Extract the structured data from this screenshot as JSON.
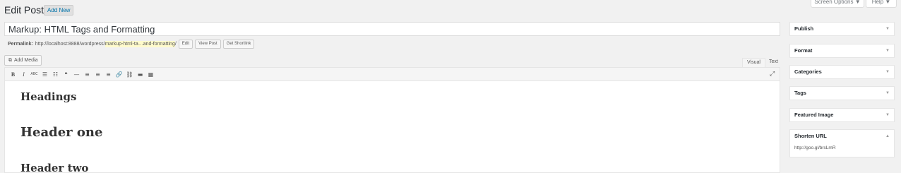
{
  "header": {
    "title": "Edit Post",
    "add_new": "Add New",
    "screen_options": "Screen Options ▼",
    "help": "Help ▼"
  },
  "post": {
    "title": "Markup: HTML Tags and Formatting",
    "permalink_label": "Permalink:",
    "permalink_base": "http://localhost:8888/wordpress/",
    "permalink_slug": "markup-html-ta…and-formatting",
    "permalink_end": "/",
    "edit_btn": "Edit",
    "view_post_btn": "View Post",
    "shortlink_btn": "Get Shortlink"
  },
  "editor": {
    "add_media": "Add Media",
    "tab_visual": "Visual",
    "tab_text": "Text",
    "toolbar": [
      "B",
      "I",
      "ABC",
      "☰",
      "☷",
      "❝",
      "—",
      "≡",
      "≡",
      "≡",
      "🔗",
      "⛓",
      "▬",
      "▦"
    ],
    "content": {
      "h_headings": "Headings",
      "h_one": "Header one",
      "h_two": "Header two"
    }
  },
  "sidebar": {
    "publish": "Publish",
    "format": "Format",
    "categories": "Categories",
    "tags": "Tags",
    "featured_image": "Featured Image",
    "shorten_url": "Shorten URL",
    "shorten_url_value": "http://goo.gl/brsLmR",
    "arrow_down": "▼",
    "arrow_up": "▲"
  }
}
